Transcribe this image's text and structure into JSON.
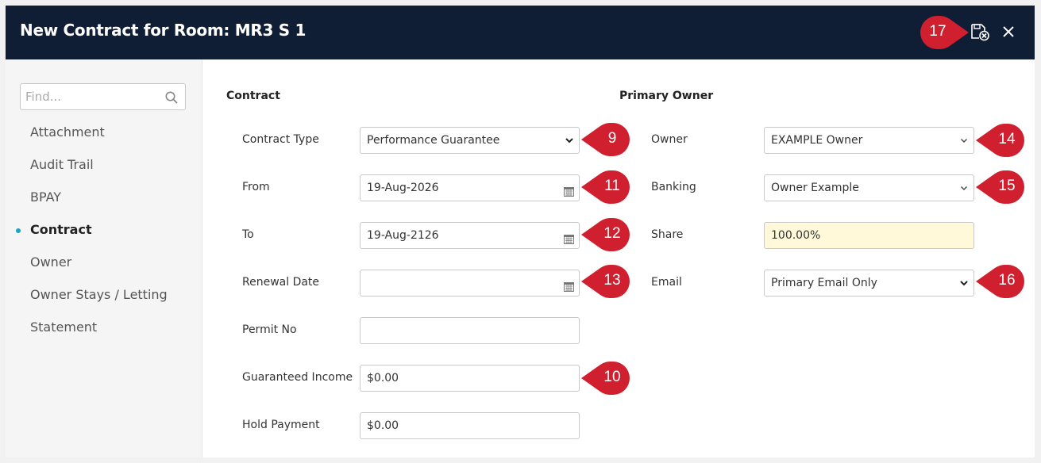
{
  "dialog": {
    "title": "New Contract for Room: MR3 S 1"
  },
  "sidebar": {
    "find_placeholder": "Find...",
    "items": [
      {
        "label": "Attachment"
      },
      {
        "label": "Audit Trail"
      },
      {
        "label": "BPAY"
      },
      {
        "label": "Contract"
      },
      {
        "label": "Owner"
      },
      {
        "label": "Owner Stays / Letting"
      },
      {
        "label": "Statement"
      }
    ],
    "active_index": 3
  },
  "contract": {
    "section_title": "Contract",
    "contract_type": {
      "label": "Contract Type",
      "value": "Performance Guarantee"
    },
    "from": {
      "label": "From",
      "value": "19-Aug-2026"
    },
    "to": {
      "label": "To",
      "value": "19-Aug-2126"
    },
    "renewal_date": {
      "label": "Renewal Date",
      "value": ""
    },
    "permit_no": {
      "label": "Permit No",
      "value": ""
    },
    "guaranteed_income": {
      "label": "Guaranteed Income",
      "value": "$0.00"
    },
    "hold_payment": {
      "label": "Hold Payment",
      "value": "$0.00"
    }
  },
  "primary_owner": {
    "section_title": "Primary Owner",
    "owner": {
      "label": "Owner",
      "value": "EXAMPLE Owner"
    },
    "banking": {
      "label": "Banking",
      "value": "Owner Example"
    },
    "share": {
      "label": "Share",
      "value": "100.00%"
    },
    "email": {
      "label": "Email",
      "value": "Primary Email Only"
    }
  },
  "markers": {
    "m9": "9",
    "m10": "10",
    "m11": "11",
    "m12": "12",
    "m13": "13",
    "m14": "14",
    "m15": "15",
    "m16": "16",
    "m17": "17"
  },
  "colors": {
    "header_bg": "#0f1d35",
    "marker_red": "#d0202f",
    "active_dot": "#17a5c7",
    "share_bg": "#fff9d9"
  },
  "icons": {
    "save": "save-cancel-icon",
    "close": "close-icon",
    "search": "search-icon",
    "calendar": "calendar-icon",
    "dropdown": "chevron-down-icon"
  }
}
